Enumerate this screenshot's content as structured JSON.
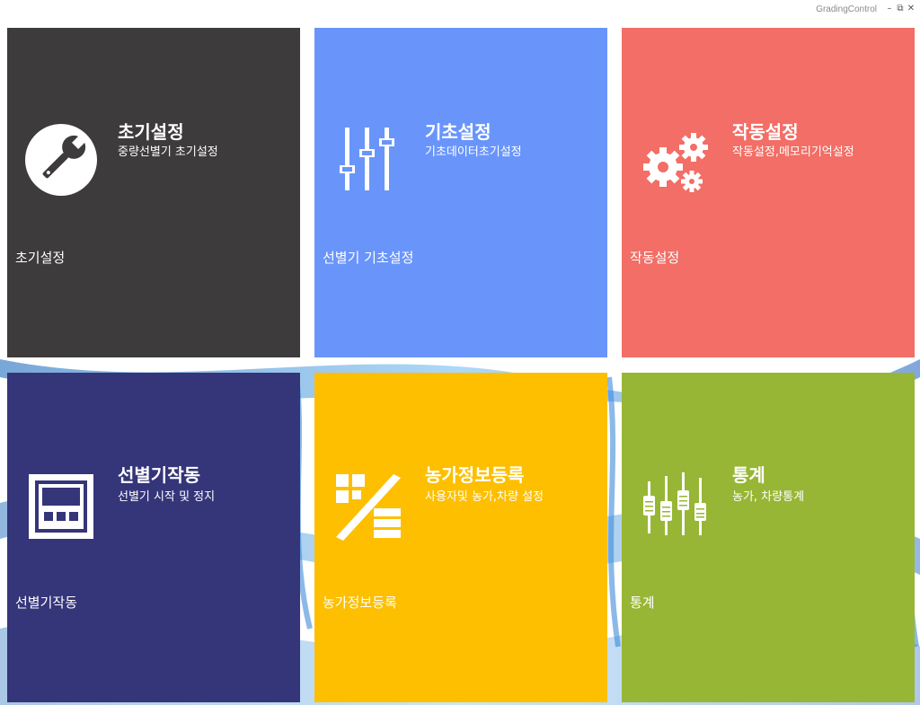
{
  "window": {
    "title": "GradingControl",
    "controls": [
      "minimize-icon",
      "restore-icon",
      "close-icon"
    ]
  },
  "colors": {
    "tile_init": "#3d3b3c",
    "tile_basic": "#6995fb",
    "tile_oper": "#f26e66",
    "tile_run": "#35357a",
    "tile_farm": "#fdbf00",
    "tile_stats": "#98b635"
  },
  "tiles": [
    {
      "id": "init",
      "heading": "초기설정",
      "sub": "중량선별기 초기설정",
      "footer": "초기설정",
      "icon": "wrench-icon"
    },
    {
      "id": "basic",
      "heading": "기초설정",
      "sub": "기초데이터초기설정",
      "footer": "선별기 기초설정",
      "icon": "sliders-icon"
    },
    {
      "id": "oper",
      "heading": "작동설정",
      "sub": "작동설정,메모리기억설정",
      "footer": "작동설정",
      "icon": "gears-icon"
    },
    {
      "id": "run",
      "heading": "선별기작동",
      "sub": "선별기 시작 및 정지",
      "footer": "선별기작동",
      "icon": "control-panel-icon"
    },
    {
      "id": "farm",
      "heading": "농가정보등록",
      "sub": "사용자및 농가,차량 설정",
      "footer": "농가정보등록",
      "icon": "registration-icon"
    },
    {
      "id": "stats",
      "heading": "통계",
      "sub": "농가, 차량통계",
      "footer": "통계",
      "icon": "statistics-icon"
    }
  ]
}
